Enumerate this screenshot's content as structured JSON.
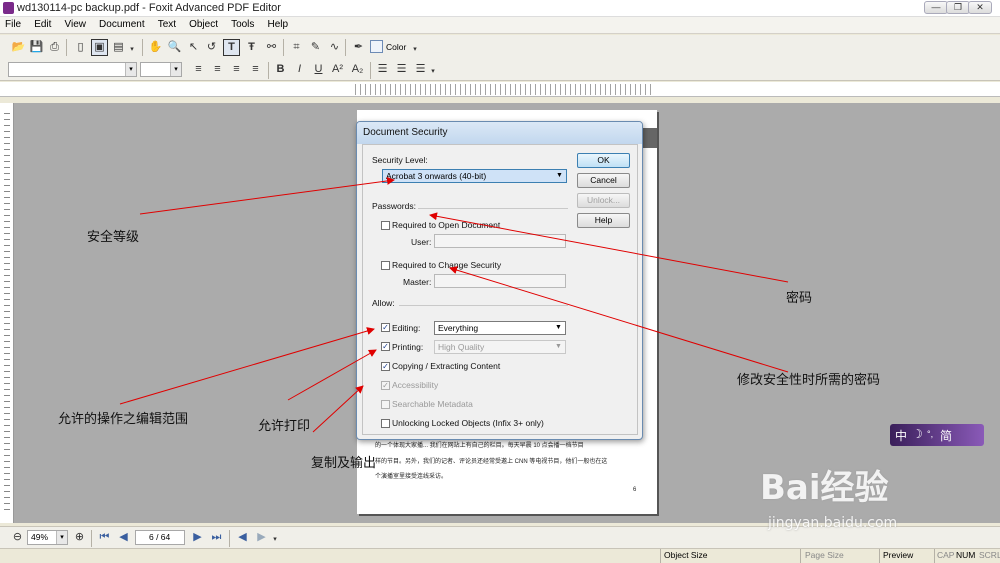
{
  "window": {
    "title": "wd130114-pc backup.pdf - Foxit Advanced PDF Editor"
  },
  "menu": [
    "File",
    "Edit",
    "View",
    "Document",
    "Text",
    "Object",
    "Tools",
    "Help"
  ],
  "toolbar": {
    "color_label": "Color"
  },
  "dialog": {
    "title": "Document Security",
    "security_level_label": "Security Level:",
    "security_level_value": "Acrobat 3 onwards (40-bit)",
    "passwords_label": "Passwords:",
    "open_doc_label": "Required to Open Document",
    "user_label": "User:",
    "change_security_label": "Required to Change Security",
    "master_label": "Master:",
    "allow_label": "Allow:",
    "editing_label": "Editing:",
    "editing_value": "Everything",
    "printing_label": "Printing:",
    "printing_value": "High Quality",
    "copying_label": "Copying / Extracting Content",
    "accessibility_label": "Accessibility",
    "searchable_label": "Searchable Metadata",
    "unlocking_label": "Unlocking Locked Objects (Infix 3+ only)",
    "buttons": {
      "ok": "OK",
      "cancel": "Cancel",
      "unlock": "Unlock...",
      "help": "Help"
    }
  },
  "annotations": {
    "security_level": "安全等级",
    "password": "密码",
    "change_security_password": "修改安全性时所需的密码",
    "allowed_editing": "允许的操作之编辑范围",
    "allow_print": "允许打印",
    "copy_output": "复制及输出"
  },
  "page_text": {
    "line1": "的一个体现大家播... 我们在网站上有自己的栏目。每天早晨 10 点会播一档节目",
    "line2": "样的节目。另外，我们的记者、评论员还经常受邀上 CNN 等电视节目，他们一般也在这",
    "line3": "个演播室里接受连线采访。",
    "page_num": "6"
  },
  "nav": {
    "zoom": "49%",
    "page": "6 / 64"
  },
  "status": {
    "object_size": "Object Size",
    "page_size": "Page Size",
    "preview": "Preview",
    "cap": "CAP",
    "num": "NUM",
    "scrl": "SCRL"
  },
  "ime": {
    "mode": "中",
    "moon": "☽",
    "dot": "°,",
    "simp": "简"
  },
  "watermark": {
    "brand": "Bai经验",
    "url": "jingyan.baidu.com"
  }
}
